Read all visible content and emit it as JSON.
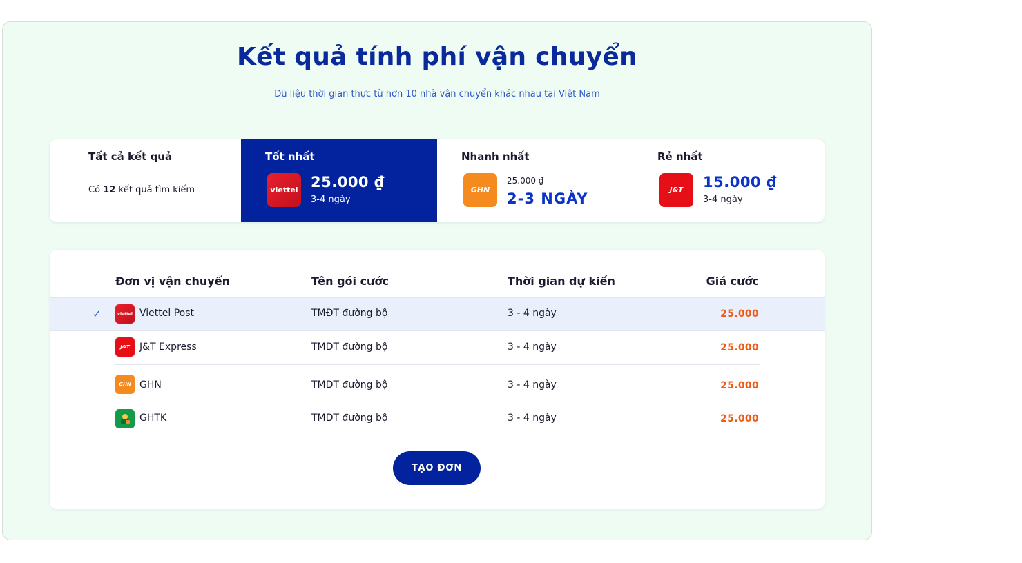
{
  "page": {
    "title": "Kết quả tính phí vận chuyển",
    "subtitle": "Dữ liệu thời gian thực từ hơn 10 nhà vận chuyển khác nhau tại Việt Nam"
  },
  "summary": {
    "all": {
      "heading": "Tất cả kết quả",
      "count_prefix": "Có ",
      "count": "12",
      "count_suffix": " kết quả tìm kiếm"
    },
    "best": {
      "heading": "Tốt nhất",
      "logo_text": "viettel",
      "price": "25.000 ₫",
      "days": "3-4 ngày"
    },
    "fastest": {
      "heading": "Nhanh nhất",
      "logo_text": "GHN",
      "price": "25.000 ₫",
      "days": "2-3 NGÀY"
    },
    "cheapest": {
      "heading": "Rẻ nhất",
      "logo_text": "J&T",
      "price": "15.000 ₫",
      "days": "3-4 ngày"
    }
  },
  "table": {
    "headers": {
      "carrier": "Đơn vị vận chuyển",
      "package": "Tên gói cước",
      "time": "Thời gian dự kiến",
      "price": "Giá cước"
    },
    "check_icon": "✓",
    "rows": [
      {
        "carrier": "Viettel Post",
        "logo_text": "viettel",
        "package": "TMĐT đường bộ",
        "time": "3 - 4 ngày",
        "price": "25.000",
        "selected": true
      },
      {
        "carrier": "J&T Express",
        "logo_text": "J&T",
        "package": "TMĐT đường bộ",
        "time": "3 - 4 ngày",
        "price": "25.000",
        "selected": false
      },
      {
        "carrier": "GHN",
        "logo_text": "GHN",
        "package": "TMĐT đường bộ",
        "time": "3 - 4 ngày",
        "price": "25.000",
        "selected": false
      },
      {
        "carrier": "GHTK",
        "logo_text": "",
        "package": "TMĐT đường bộ",
        "time": "3 - 4 ngày",
        "price": "25.000",
        "selected": false
      }
    ]
  },
  "actions": {
    "create_label": "TẠO ĐƠN"
  },
  "colors": {
    "brand_blue": "#03239e",
    "price_orange": "#f05a13",
    "panel_bg": "#effcf4"
  }
}
